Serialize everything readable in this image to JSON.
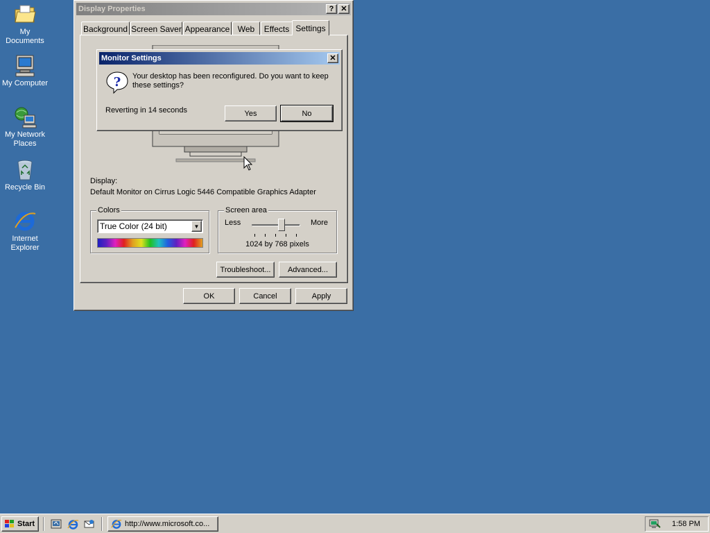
{
  "desktop": {
    "icons": [
      {
        "label": "My Documents"
      },
      {
        "label": "My Computer"
      },
      {
        "label": "My Network Places"
      },
      {
        "label": "Recycle Bin"
      },
      {
        "label": "Internet Explorer"
      }
    ]
  },
  "display_properties": {
    "title": "Display Properties",
    "help_label": "?",
    "close_label": "✕",
    "tabs": [
      "Background",
      "Screen Saver",
      "Appearance",
      "Web",
      "Effects",
      "Settings"
    ],
    "selected_tab": "Settings",
    "display_label": "Display:",
    "display_value": "Default Monitor on Cirrus Logic 5446 Compatible Graphics Adapter",
    "colors": {
      "legend": "Colors",
      "selected": "True Color (24 bit)"
    },
    "screen_area": {
      "legend": "Screen area",
      "less_label": "Less",
      "more_label": "More",
      "value_label": "1024 by 768 pixels",
      "slider_fraction": 0.5
    },
    "troubleshoot_label": "Troubleshoot...",
    "advanced_label": "Advanced...",
    "ok_label": "OK",
    "cancel_label": "Cancel",
    "apply_label": "Apply"
  },
  "monitor_settings": {
    "title": "Monitor Settings",
    "close_label": "✕",
    "message": "Your desktop has been reconfigured.  Do you want to keep these settings?",
    "countdown": "Reverting in 14 seconds",
    "yes_label": "Yes",
    "no_label": "No"
  },
  "taskbar": {
    "start_label": "Start",
    "task_button_label": "http://www.microsoft.co...",
    "clock": "1:58 PM"
  },
  "colors": {
    "desktop": "#3a6ea5",
    "face": "#d4d0c8",
    "active_title_start": "#0a246a",
    "active_title_end": "#a6caf0"
  }
}
